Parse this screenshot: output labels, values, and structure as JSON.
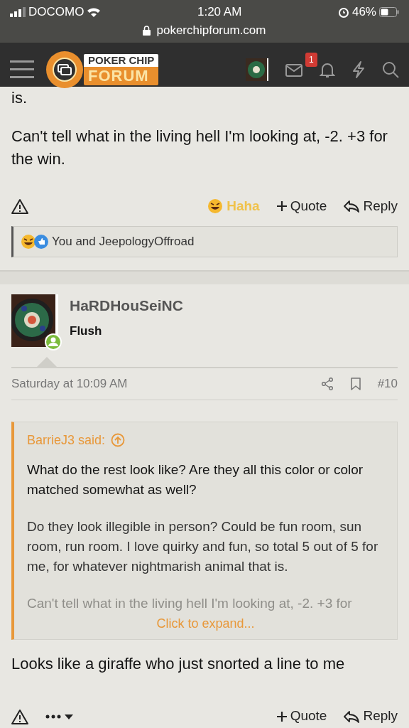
{
  "status_bar": {
    "carrier": "DOCOMO",
    "time": "1:20 AM",
    "battery": "46%",
    "url": "pokerchipforum.com"
  },
  "header": {
    "logo_top": "POKER CHIP",
    "logo_bottom": "FORUM",
    "notification_count": "1"
  },
  "posts": [
    {
      "truncated_text": "is.",
      "message": "Can't tell what in the living hell I'm looking at, -2. +3 for the win.",
      "actions": [
        {
          "kind": "react",
          "label": "Haha",
          "reacted": true
        },
        {
          "kind": "quote",
          "label": "Quote"
        },
        {
          "kind": "reply",
          "label": "Reply"
        }
      ],
      "reactions": "You and JeepologyOffroad"
    },
    {
      "author": "HaRDHouSeiNC",
      "rank": "Flush",
      "online": true,
      "date": "Saturday at 10:09 AM",
      "number": "#10",
      "quote": {
        "author": "BarrieJ3 said:",
        "paragraphs": [
          "What do the rest look like? Are they all this color or color matched somewhat as well?",
          "Do they look illegible in person? Could be fun room, sun room, run room. I love quirky and fun, so total 5 out of 5 for me, for whatever nightmarish animal that is."
        ],
        "faded_line": "Can't tell what in the living hell I'm looking at, -2. +3 for",
        "expand": "Click to expand..."
      },
      "message": "Looks like a giraffe who just snorted a line to me",
      "actions": [
        {
          "kind": "more"
        },
        {
          "kind": "quote",
          "label": "Quote"
        },
        {
          "kind": "reply",
          "label": "Reply"
        }
      ]
    }
  ]
}
